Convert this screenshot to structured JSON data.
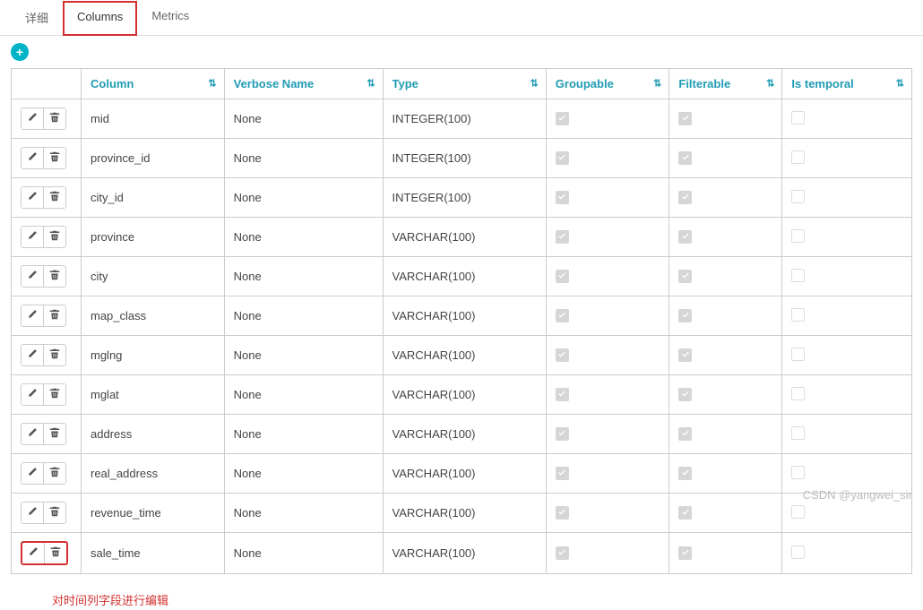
{
  "tabs": [
    {
      "label": "详细",
      "active": false
    },
    {
      "label": "Columns",
      "active": true
    },
    {
      "label": "Metrics",
      "active": false
    }
  ],
  "headers": {
    "column": "Column",
    "verbose": "Verbose Name",
    "type": "Type",
    "groupable": "Groupable",
    "filterable": "Filterable",
    "temporal": "Is temporal"
  },
  "rows": [
    {
      "col": "mid",
      "verbose": "None",
      "type": "INTEGER(100)",
      "groupable": true,
      "filterable": true,
      "temporal": false,
      "highlight": false
    },
    {
      "col": "province_id",
      "verbose": "None",
      "type": "INTEGER(100)",
      "groupable": true,
      "filterable": true,
      "temporal": false,
      "highlight": false
    },
    {
      "col": "city_id",
      "verbose": "None",
      "type": "INTEGER(100)",
      "groupable": true,
      "filterable": true,
      "temporal": false,
      "highlight": false
    },
    {
      "col": "province",
      "verbose": "None",
      "type": "VARCHAR(100)",
      "groupable": true,
      "filterable": true,
      "temporal": false,
      "highlight": false
    },
    {
      "col": "city",
      "verbose": "None",
      "type": "VARCHAR(100)",
      "groupable": true,
      "filterable": true,
      "temporal": false,
      "highlight": false
    },
    {
      "col": "map_class",
      "verbose": "None",
      "type": "VARCHAR(100)",
      "groupable": true,
      "filterable": true,
      "temporal": false,
      "highlight": false
    },
    {
      "col": "mglng",
      "verbose": "None",
      "type": "VARCHAR(100)",
      "groupable": true,
      "filterable": true,
      "temporal": false,
      "highlight": false
    },
    {
      "col": "mglat",
      "verbose": "None",
      "type": "VARCHAR(100)",
      "groupable": true,
      "filterable": true,
      "temporal": false,
      "highlight": false
    },
    {
      "col": "address",
      "verbose": "None",
      "type": "VARCHAR(100)",
      "groupable": true,
      "filterable": true,
      "temporal": false,
      "highlight": false
    },
    {
      "col": "real_address",
      "verbose": "None",
      "type": "VARCHAR(100)",
      "groupable": true,
      "filterable": true,
      "temporal": false,
      "highlight": false
    },
    {
      "col": "revenue_time",
      "verbose": "None",
      "type": "VARCHAR(100)",
      "groupable": true,
      "filterable": true,
      "temporal": false,
      "highlight": false
    },
    {
      "col": "sale_time",
      "verbose": "None",
      "type": "VARCHAR(100)",
      "groupable": true,
      "filterable": true,
      "temporal": false,
      "highlight": true
    }
  ],
  "annotation": "对时间列字段进行编辑",
  "watermark": "CSDN @yangwei_sir",
  "icons": {
    "plus": "+",
    "sort": "⇅"
  }
}
